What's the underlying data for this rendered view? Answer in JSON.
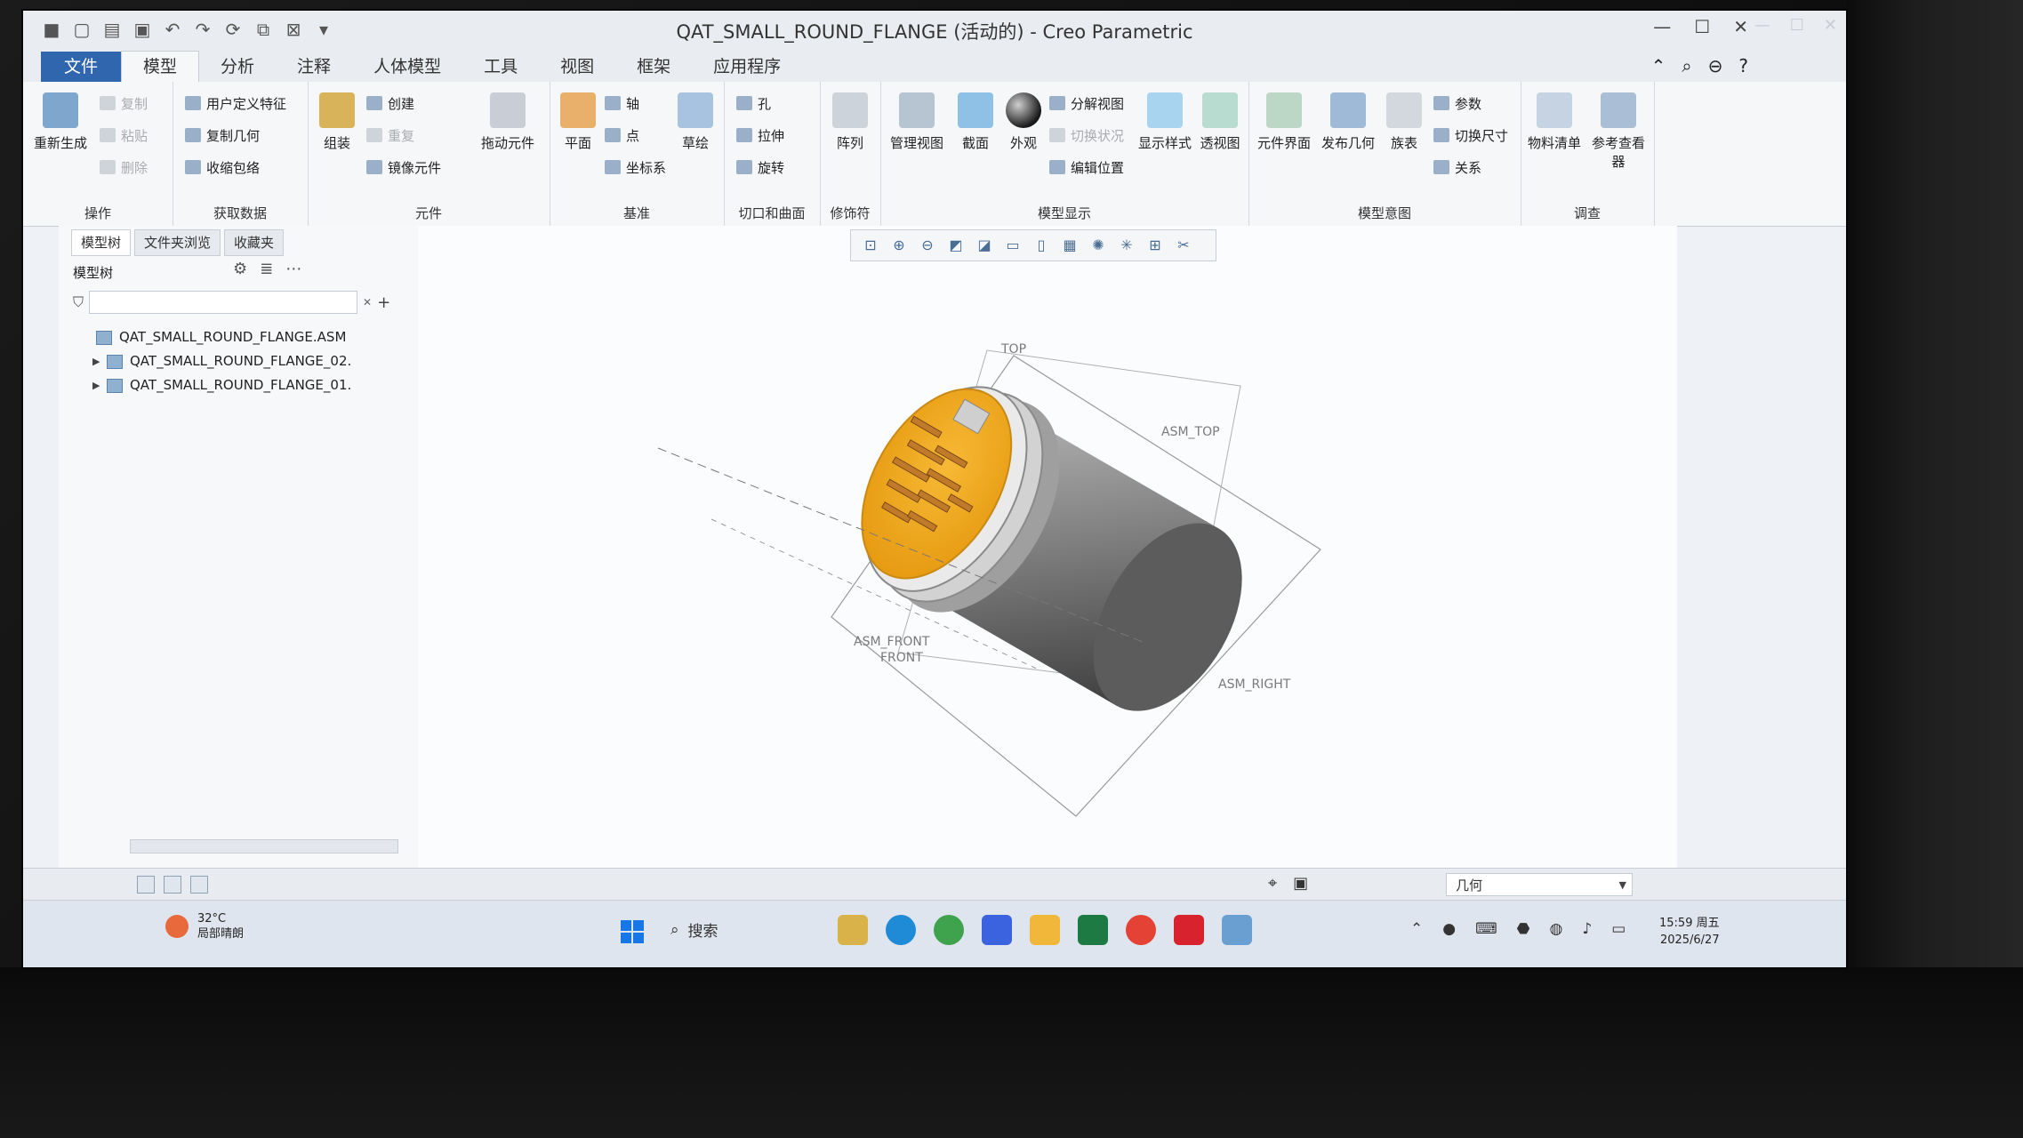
{
  "window": {
    "title": "QAT_SMALL_ROUND_FLANGE (活动的) - Creo Parametric"
  },
  "tabs": [
    {
      "label": "文件"
    },
    {
      "label": "模型"
    },
    {
      "label": "分析"
    },
    {
      "label": "注释"
    },
    {
      "label": "人体模型"
    },
    {
      "label": "工具"
    },
    {
      "label": "视图"
    },
    {
      "label": "框架"
    },
    {
      "label": "应用程序"
    }
  ],
  "ribbon": {
    "operations": {
      "regenerate": "重新生成",
      "copy": "复制",
      "paste": "粘贴",
      "delete": "删除",
      "label": "操作"
    },
    "get_data": {
      "udf": "用户定义特征",
      "copy_geom": "复制几何",
      "shrinkwrap": "收缩包络",
      "label": "获取数据"
    },
    "component": {
      "assemble": "组装",
      "create": "创建",
      "repeat": "重复",
      "mirror": "镜像元件",
      "drag": "拖动元件",
      "label": "元件"
    },
    "datum": {
      "plane": "平面",
      "axis": "轴",
      "point": "点",
      "csys": "坐标系",
      "sketch": "草绘",
      "label": "基准"
    },
    "cut_surface": {
      "hole": "孔",
      "extrude": "拉伸",
      "revolve": "旋转",
      "label": "切口和曲面"
    },
    "modifiers": {
      "pattern": "阵列",
      "label": "修饰符"
    },
    "model_display": {
      "manage_views": "管理视图",
      "section": "截面",
      "appearance": "外观",
      "exploded": "分解视图",
      "toggle_status": "切换状况",
      "edit_position": "编辑位置",
      "display_style": "显示样式",
      "perspective": "透视图",
      "label": "模型显示"
    },
    "model_intent": {
      "component_interface": "元件界面",
      "publish_geom": "发布几何",
      "family_table": "族表",
      "parameters": "参数",
      "switch_dims": "切换尺寸",
      "relations": "关系",
      "label": "模型意图"
    },
    "investigate": {
      "bom": "物料清单",
      "ref_viewer": "参考查看器",
      "label": "调查"
    }
  },
  "panel": {
    "tabs": [
      "模型树",
      "文件夹浏览",
      "收藏夹"
    ],
    "tree_header": "模型树",
    "nodes": [
      {
        "label": "QAT_SMALL_ROUND_FLANGE.ASM"
      },
      {
        "label": "QAT_SMALL_ROUND_FLANGE_02."
      },
      {
        "label": "QAT_SMALL_ROUND_FLANGE_01."
      }
    ]
  },
  "viewport": {
    "labels": {
      "top": "TOP",
      "asm_top": "ASM_TOP",
      "asm_front": "ASM_FRONT",
      "front": "FRONT",
      "asm_right": "ASM_RIGHT"
    },
    "colors": {
      "face": "#f0a81e",
      "body": "#7d7d7d",
      "pins": "#c07a2a"
    }
  },
  "statusbar": {
    "filter_value": "几何"
  },
  "taskbar": {
    "temperature": "32°C",
    "weather": "局部晴朗",
    "search_label": "搜索",
    "time": "15:59 周五",
    "date": "2025/6/27"
  }
}
